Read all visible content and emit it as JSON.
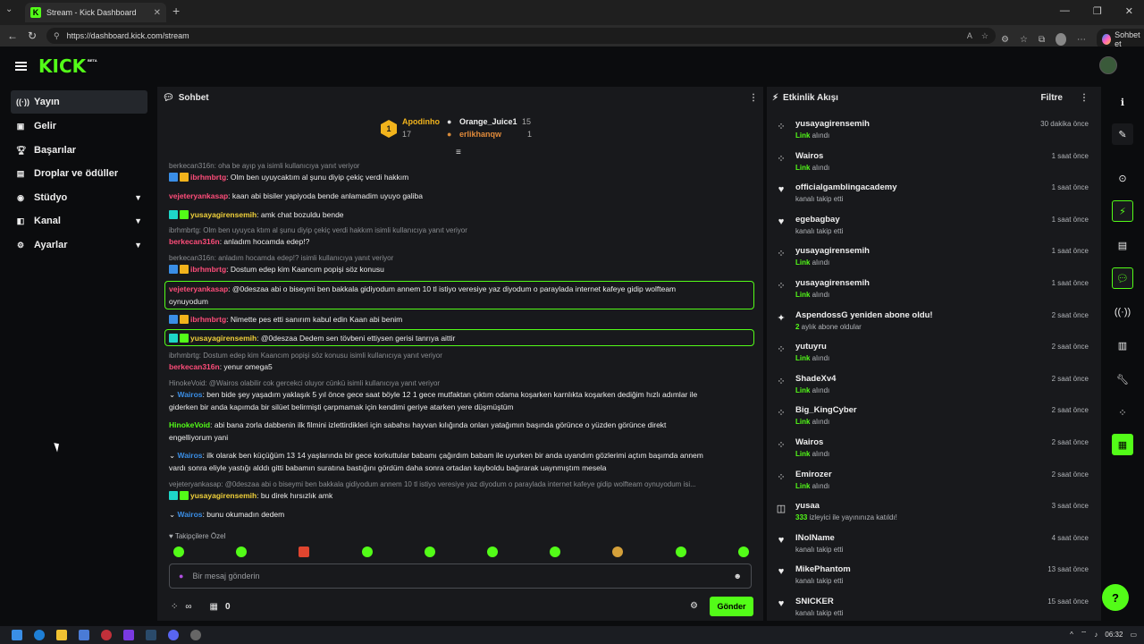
{
  "browser": {
    "tab_title": "Stream - Kick Dashboard",
    "url": "https://dashboard.kick.com/stream",
    "copilot_label": "Sohbet et"
  },
  "brand": {
    "logo": "KICK",
    "beta": "BETA",
    "accent": "#53fc18"
  },
  "sidebar": {
    "items": [
      {
        "label": "Yayın",
        "icon": "broadcast-icon",
        "active": true
      },
      {
        "label": "Gelir",
        "icon": "revenue-icon"
      },
      {
        "label": "Başarılar",
        "icon": "trophy-icon"
      },
      {
        "label": "Droplar ve ödüller",
        "icon": "gift-icon"
      },
      {
        "label": "Stüdyo",
        "icon": "camera-icon",
        "expandable": true
      },
      {
        "label": "Kanal",
        "icon": "channel-icon",
        "expandable": true
      },
      {
        "label": "Ayarlar",
        "icon": "gear-icon",
        "expandable": true
      }
    ]
  },
  "chat": {
    "title": "Sohbet",
    "leaderboard": {
      "first": {
        "name": "Apodinho",
        "count": "17"
      },
      "second": {
        "name": "Orange_Juice1",
        "count": "15"
      },
      "third": {
        "name": "erlikhanqw",
        "count": "1"
      }
    },
    "messages": [
      {
        "reply": "berkecan316n: oha be ayıp ya isimli kullanıcıya yanıt veriyor",
        "user": "ibrhmbrtg",
        "text": ": Olm ben uyuycaktım al şunu diyip çekiç verdi hakkım"
      },
      {
        "user": "vejeteryankasap",
        "text": ": kaan abi bisiler yapiyoda bende anlamadim uyuyo galiba"
      },
      {
        "user": "yusayagirensemih",
        "text": ": amk chat bozuldu bende"
      },
      {
        "reply": "ibrhmbrtg: Olm ben uyuyca ktım al şunu diyip çekiç verdi hakkım isimli kullanıcıya yanıt veriyor",
        "user": "berkecan316n",
        "text": ": anladım hocamda edep!?"
      },
      {
        "reply": "berkecan316n: anladım hocamda edep!? isimli kullanıcıya yanıt veriyor",
        "user": "ibrhmbrtg",
        "text": ": Dostum edep kim Kaancım popişi söz konusu"
      },
      {
        "user": "vejeteryankasap",
        "text": ": @0deszaa abi o biseymi ben bakkala gidiyodum annem 10 tl istiyo veresiye yaz diyodum o paraylada internet kafeye gidip wolfteam",
        "text2": "oynuyodum"
      },
      {
        "user": "ibrhmbrtg",
        "text": ": Nimette pes etti sanırım kabul edin Kaan abi benim"
      },
      {
        "user": "yusayagirensemih",
        "text": ": @0deszaa Dedem sen tövbeni ettiysen gerisi tanrıya aittir"
      },
      {
        "reply": "ibrhmbrtg: Dostum edep kim Kaancım popişi söz konusu isimli kullanıcıya yanıt veriyor",
        "user": "berkecan316n",
        "text": ": yenur omega5"
      },
      {
        "reply": "HinokeVoid: @Wairos olabilir cok gercekci oluyor cünkü isimli kullanıcıya yanıt veriyor",
        "user": "Wairos",
        "text": ": ben bide şey yaşadım yaklaşık 5 yıl önce gece saat böyle 12 1 gece mutfaktan çıktım odama koşarken karnlıkta koşarken dediğim hızlı adımlar ile",
        "text2": "giderken bir anda kapımda bir silüet belirmişti çarpmamak için kendimi geriye atarken yere düşmüştüm"
      },
      {
        "user": "HinokeVoid",
        "text": ": abi bana zorla dabbenin ilk filmini izlettirdikleri için sabahsı hayvan kılığında onları yatağımın başında görünce o yüzden görünce direkt",
        "text2": "engelliyorum yani"
      },
      {
        "user": "Wairos",
        "text": ": ilk olarak ben küçüğüm 13 14 yaşlarında bir gece korkuttular babamı çağırdım babam ile uyurken bir anda uyandım gözlerimi açtım başımda annem",
        "text2": "vardı sonra eliyle yastığı alddı gitti babamın suratına bastığını gördüm daha sonra ortadan kayboldu bağırarak uaynmıştım mesela"
      },
      {
        "reply": "vejeteryankasap: @0deszaa abi o biseymi ben bakkala gidiyodum annem 10 tl istiyo veresiye yaz diyodum o paraylada internet kafeye gidip wolfteam oynuyodum isi...",
        "user": "yusayagirensemih",
        "text": ": bu direk hırsızlık amk"
      },
      {
        "user": "Wairos",
        "text": ": bunu okumadın dedem"
      }
    ],
    "followers_only": "Takipçilere Özel",
    "input_placeholder": "Bir mesaj gönderin",
    "bottom": {
      "infinity": "∞",
      "count": "0",
      "send_label": "Gönder"
    }
  },
  "feed": {
    "title": "Etkinlik Akışı",
    "filter_label": "Filtre",
    "events": [
      {
        "icon": "dots-icon",
        "name": "yusayagirensemih",
        "sub_hl": "Link",
        "sub": " alındı",
        "time": "30 dakika önce"
      },
      {
        "icon": "dots-icon",
        "name": "Wairos",
        "sub_hl": "Link",
        "sub": " alındı",
        "time": "1 saat önce"
      },
      {
        "icon": "heart-icon",
        "name": "officialgamblingacademy",
        "sub_hl": "",
        "sub": "kanalı takip etti",
        "time": "1 saat önce"
      },
      {
        "icon": "heart-icon",
        "name": "egebagbay",
        "sub_hl": "",
        "sub": "kanalı takip etti",
        "time": "1 saat önce"
      },
      {
        "icon": "dots-icon",
        "name": "yusayagirensemih",
        "sub_hl": "Link",
        "sub": " alındı",
        "time": "1 saat önce"
      },
      {
        "icon": "dots-icon",
        "name": "yusayagirensemih",
        "sub_hl": "Link",
        "sub": " alındı",
        "time": "1 saat önce"
      },
      {
        "icon": "star-icon",
        "name": "AspendossG yeniden abone oldu!",
        "sub_hl": "2",
        "sub": " aylık abone oldular",
        "time": "2 saat önce"
      },
      {
        "icon": "dots-icon",
        "name": "yutuyru",
        "sub_hl": "Link",
        "sub": " alındı",
        "time": "2 saat önce"
      },
      {
        "icon": "dots-icon",
        "name": "ShadeXv4",
        "sub_hl": "Link",
        "sub": " alındı",
        "time": "2 saat önce"
      },
      {
        "icon": "dots-icon",
        "name": "Big_KingCyber",
        "sub_hl": "Link",
        "sub": " alındı",
        "time": "2 saat önce"
      },
      {
        "icon": "dots-icon",
        "name": "Wairos",
        "sub_hl": "Link",
        "sub": " alındı",
        "time": "2 saat önce"
      },
      {
        "icon": "dots-icon",
        "name": "Emirozer",
        "sub_hl": "Link",
        "sub": " alındı",
        "time": "2 saat önce"
      },
      {
        "icon": "raid-icon",
        "name": "yusaa",
        "sub_hl": "333",
        "sub": " izleyici ile yayınınıza katıldı!",
        "time": "3 saat önce"
      },
      {
        "icon": "heart-icon",
        "name": "INolName",
        "sub_hl": "",
        "sub": "kanalı takip etti",
        "time": "4 saat önce"
      },
      {
        "icon": "heart-icon",
        "name": "MikePhantom",
        "sub_hl": "",
        "sub": "kanalı takip etti",
        "time": "13 saat önce"
      },
      {
        "icon": "heart-icon",
        "name": "SNICKER",
        "sub_hl": "",
        "sub": "kanalı takip etti",
        "time": "15 saat önce"
      }
    ]
  },
  "taskbar": {
    "time": "06:32"
  }
}
